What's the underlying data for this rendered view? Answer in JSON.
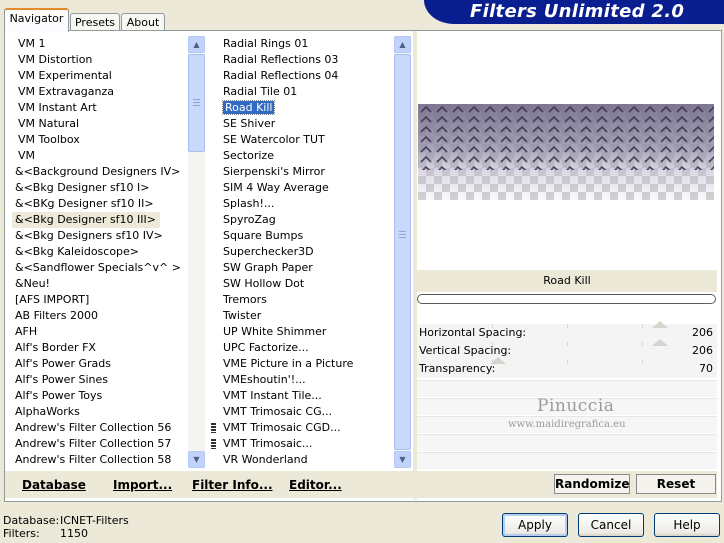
{
  "tabs": [
    "Navigator",
    "Presets",
    "About"
  ],
  "app_title": "Filters Unlimited 2.0",
  "categories": [
    "VM 1",
    "VM Distortion",
    "VM Experimental",
    "VM Extravaganza",
    "VM Instant Art",
    "VM Natural",
    "VM Toolbox",
    "VM",
    "&<Background Designers IV>",
    "&<Bkg Designer sf10 I>",
    "&<BKg Designer sf10 II>",
    "&<Bkg Designer sf10 III>",
    "&<Bkg Designers sf10 IV>",
    "&<Bkg Kaleidoscope>",
    "&<Sandflower Specials^v^ >",
    "&Neu!",
    "[AFS IMPORT]",
    "AB Filters 2000",
    "AFH",
    "Alf's Border FX",
    "Alf's Power Grads",
    "Alf's Power Sines",
    "Alf's Power Toys",
    "AlphaWorks",
    "Andrew's Filter Collection 56",
    "Andrew's Filter Collection 57",
    "Andrew's Filter Collection 58"
  ],
  "selected_category": "&<Bkg Designer sf10 III>",
  "filters": [
    "Radial  Rings 01",
    "Radial Reflections 03",
    "Radial Reflections 04",
    "Radial Tile 01",
    "Road Kill",
    "SE Shiver",
    "SE Watercolor TUT",
    "Sectorize",
    "Sierpenski's Mirror",
    "SIM 4 Way Average",
    "Splash!...",
    "SpyroZag",
    "Square Bumps",
    "Superchecker3D",
    "SW Graph Paper",
    "SW Hollow Dot",
    "Tremors",
    "Twister",
    "UP White Shimmer",
    "UPC Factorize...",
    "VME Picture in a Picture",
    "VMEshoutin'!...",
    "VMT Instant Tile...",
    "VMT Trimosaic CG...",
    "VMT Trimosaic CGD...",
    "VMT Trimosaic...",
    "VR Wonderland"
  ],
  "selected_filter": "Road Kill",
  "filter_name_display": "Road Kill",
  "params": [
    {
      "label": "Horizontal Spacing:",
      "value": "206",
      "fraction": 0.81
    },
    {
      "label": "Vertical Spacing:",
      "value": "206",
      "fraction": 0.81
    },
    {
      "label": "Transparency:",
      "value": "70",
      "fraction": 0.27
    }
  ],
  "watermark": {
    "line1": "Pinuccia",
    "line2": "www.maidiregrafica.eu"
  },
  "toolbar": {
    "database": "Database",
    "import": "Import...",
    "filter_info": "Filter Info...",
    "editor": "Editor..."
  },
  "right_buttons": {
    "randomize": "Randomize",
    "reset": "Reset"
  },
  "footer": {
    "database_label": "Database:",
    "database_value": "ICNET-Filters",
    "filters_label": "Filters:",
    "filters_value": "1150"
  },
  "dialog_buttons": {
    "apply": "Apply",
    "cancel": "Cancel",
    "help": "Help"
  },
  "colors": {
    "banner": "#0a1f8f",
    "selection": "#316ac5",
    "preview_pattern": "#6e6586"
  }
}
